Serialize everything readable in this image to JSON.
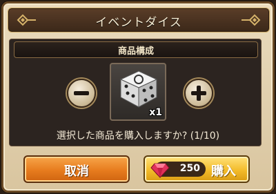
{
  "dialog": {
    "title": "イベントダイス",
    "section_header": "商品構成",
    "confirm_message": "選択した商品を購入しますか? (1/10)"
  },
  "item": {
    "icon": "dice-icon",
    "quantity": "x1"
  },
  "buttons": {
    "cancel_label": "取消",
    "buy_label": "購入",
    "price": "250",
    "currency_icon": "ruby-gem-icon"
  },
  "colors": {
    "cancel": "#e77c1e",
    "buy": "#f3bb2b",
    "title_bar": "#4a3222"
  }
}
